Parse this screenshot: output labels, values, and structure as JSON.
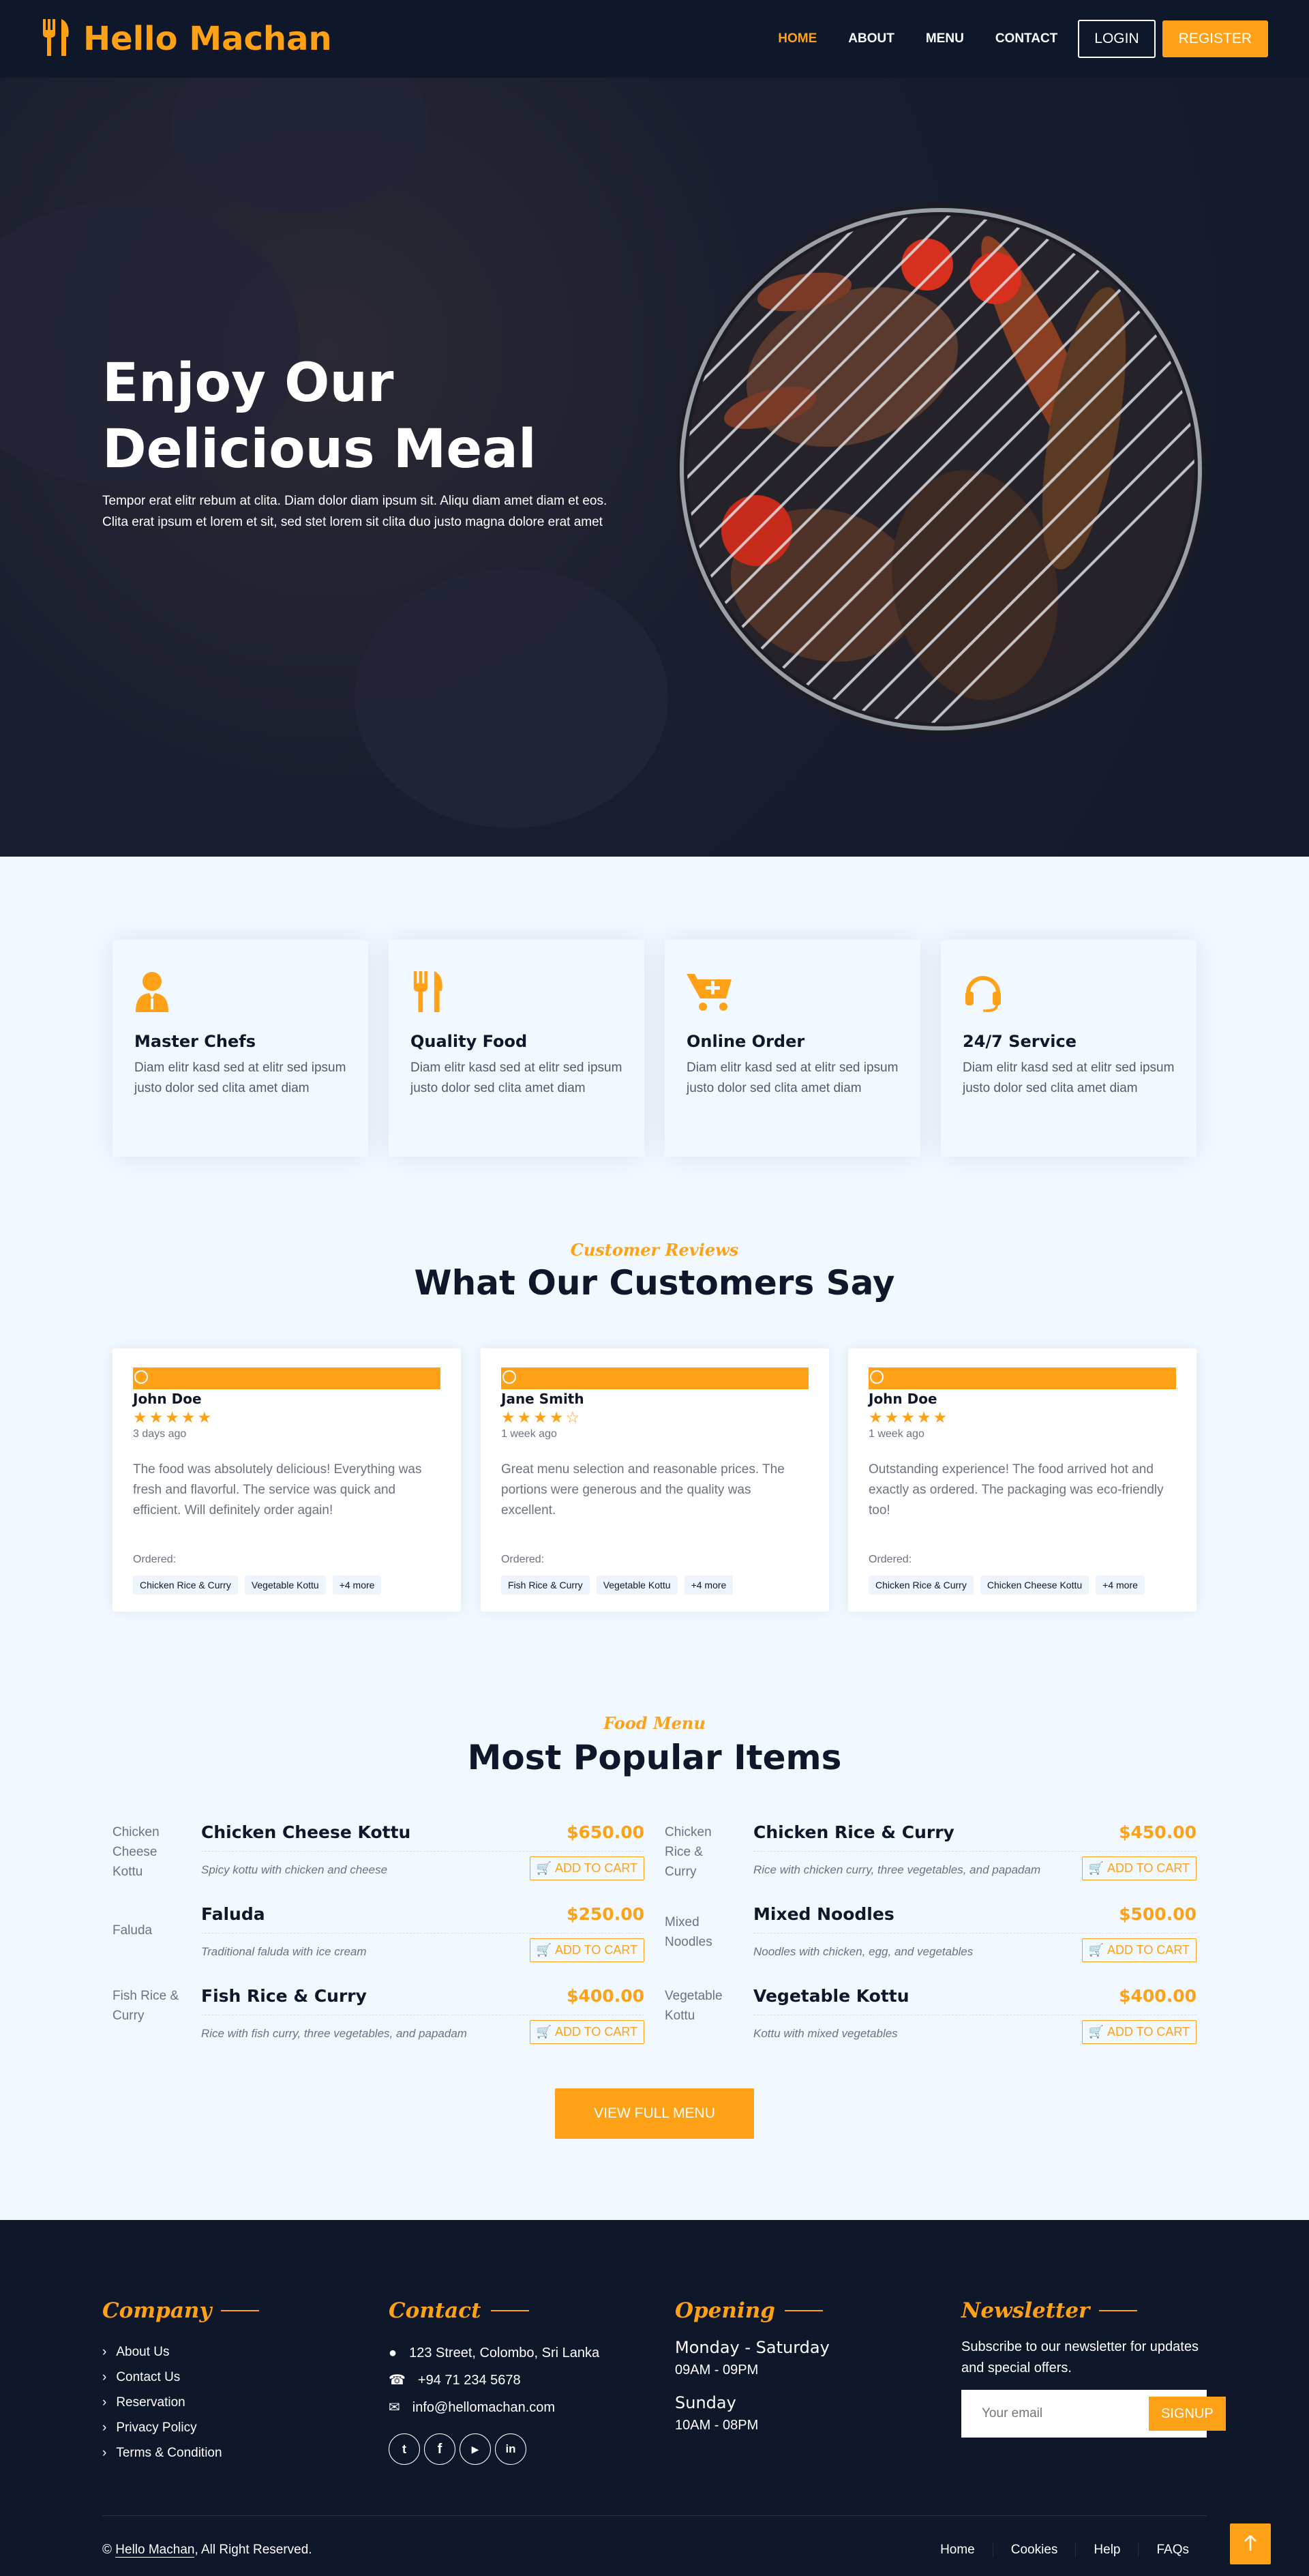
{
  "nav": {
    "brand": "Hello Machan",
    "links": [
      "Home",
      "About",
      "Menu",
      "Contact"
    ],
    "login": "LOGIN",
    "register": "REGISTER"
  },
  "hero": {
    "title": "Enjoy Our Delicious Meal",
    "text": "Tempor erat elitr rebum at clita. Diam dolor diam ipsum sit. Aliqu diam amet diam et eos. Clita erat ipsum et lorem et sit, sed stet lorem sit clita duo justo magna dolore erat amet"
  },
  "services": [
    {
      "icon": "chef-icon",
      "title": "Master Chefs",
      "text": "Diam elitr kasd sed at elitr sed ipsum justo dolor sed clita amet diam"
    },
    {
      "icon": "utensils-icon",
      "title": "Quality Food",
      "text": "Diam elitr kasd sed at elitr sed ipsum justo dolor sed clita amet diam"
    },
    {
      "icon": "cart-plus-icon",
      "title": "Online Order",
      "text": "Diam elitr kasd sed at elitr sed ipsum justo dolor sed clita amet diam"
    },
    {
      "icon": "headset-icon",
      "title": "24/7 Service",
      "text": "Diam elitr kasd sed at elitr sed ipsum justo dolor sed clita amet diam"
    }
  ],
  "reviews_section": {
    "subtitle": "Customer Reviews",
    "title": "What Our Customers Say",
    "ordered_label": "Ordered:",
    "items": [
      {
        "name": "John Doe",
        "rating": 5,
        "stars": "★★★★★",
        "date": "3 days ago",
        "text": "The food was absolutely delicious! Everything was fresh and flavorful. The service was quick and efficient. Will definitely order again!",
        "tags": [
          "Chicken Rice & Curry",
          "Vegetable Kottu",
          "+4 more"
        ]
      },
      {
        "name": "Jane Smith",
        "rating": 4,
        "stars": "★★★★☆",
        "date": "1 week ago",
        "text": "Great menu selection and reasonable prices. The portions were generous and the quality was excellent.",
        "tags": [
          "Fish Rice & Curry",
          "Vegetable Kottu",
          "+4 more"
        ]
      },
      {
        "name": "John Doe",
        "rating": 5,
        "stars": "★★★★★",
        "date": "1 week ago",
        "text": "Outstanding experience! The food arrived hot and exactly as ordered. The packaging was eco-friendly too!",
        "tags": [
          "Chicken Rice & Curry",
          "Chicken Cheese Kottu",
          "+4 more"
        ]
      }
    ]
  },
  "menu_section": {
    "subtitle": "Food Menu",
    "title": "Most Popular Items",
    "cart_label": "ADD TO CART",
    "items": [
      {
        "img_alt": "Chicken Cheese Kottu",
        "name": "Chicken Cheese Kottu",
        "price": "$650.00",
        "desc": "Spicy kottu with chicken and cheese"
      },
      {
        "img_alt": "Chicken Rice & Curry",
        "name": "Chicken Rice & Curry",
        "price": "$450.00",
        "desc": "Rice with chicken curry, three vegetables, and papadam"
      },
      {
        "img_alt": "Faluda",
        "name": "Faluda",
        "price": "$250.00",
        "desc": "Traditional faluda with ice cream"
      },
      {
        "img_alt": "Mixed Noodles",
        "name": "Mixed Noodles",
        "price": "$500.00",
        "desc": "Noodles with chicken, egg, and vegetables"
      },
      {
        "img_alt": "Fish Rice & Curry",
        "name": "Fish Rice & Curry",
        "price": "$400.00",
        "desc": "Rice with fish curry, three vegetables, and papadam"
      },
      {
        "img_alt": "Vegetable Kottu",
        "name": "Vegetable Kottu",
        "price": "$400.00",
        "desc": "Kottu with mixed vegetables"
      }
    ],
    "full_menu_label": "VIEW FULL MENU"
  },
  "footer": {
    "company": {
      "heading": "Company",
      "links": [
        "About Us",
        "Contact Us",
        "Reservation",
        "Privacy Policy",
        "Terms & Condition"
      ]
    },
    "contact": {
      "heading": "Contact",
      "address": "123 Street, Colombo, Sri Lanka",
      "phone": "+94 71 234 5678",
      "email": "info@hellomachan.com",
      "socials": [
        "twitter-icon",
        "facebook-icon",
        "youtube-icon",
        "linkedin-icon"
      ]
    },
    "opening": {
      "heading": "Opening",
      "day1": "Monday - Saturday",
      "time1": "09AM - 09PM",
      "day2": "Sunday",
      "time2": "10AM - 08PM"
    },
    "newsletter": {
      "heading": "Newsletter",
      "text": "Subscribe to our newsletter for updates and special offers.",
      "placeholder": "Your email",
      "button": "SIGNUP"
    },
    "copyright_symbol": "©",
    "copyright_brand": "Hello Machan",
    "copyright_rest": ", All Right Reserved.",
    "bottom_links": [
      "Home",
      "Cookies",
      "Help",
      "FAQs"
    ]
  },
  "colors": {
    "primary": "#fea116",
    "dark": "#0f172b",
    "light": "#f1f8ff"
  }
}
